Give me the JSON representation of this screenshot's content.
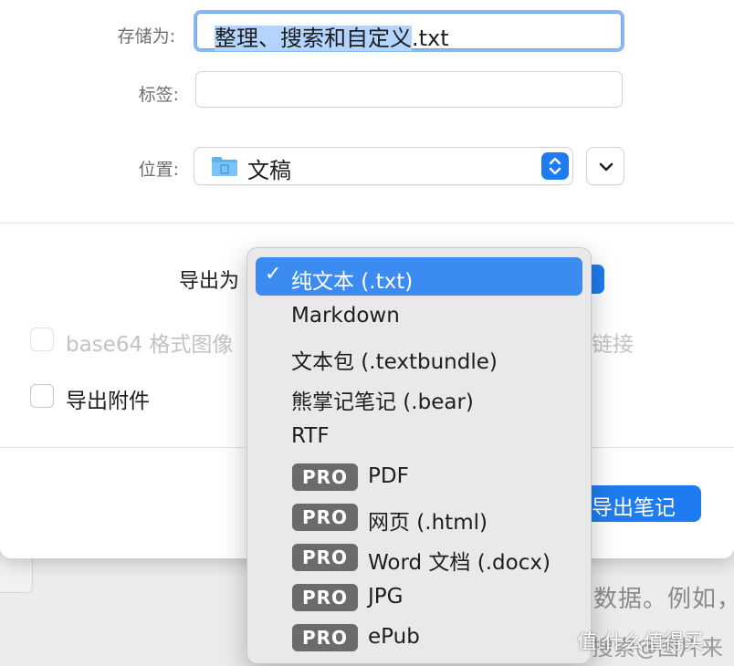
{
  "dialog": {
    "save_as_label": "存储为:",
    "filename_selected": "整理、搜索和自定义",
    "filename_ext": ".txt",
    "tags_label": "标签:",
    "tags_value": "",
    "location_label": "位置:",
    "location_value": "文稿",
    "export_label": "导出为",
    "base64_label": "base64 格式图像",
    "base64_tail": "链接",
    "attachments_label": "导出附件",
    "primary_button": "导出笔记"
  },
  "menu": {
    "checkmark": "✓",
    "pro_badge": "PRO",
    "items": [
      {
        "label": "纯文本 (.txt)",
        "selected": true,
        "pro": false
      },
      {
        "label": "Markdown",
        "selected": false,
        "pro": false
      },
      {
        "label": "文本包 (.textbundle)",
        "selected": false,
        "pro": false
      },
      {
        "label": "熊掌记笔记 (.bear)",
        "selected": false,
        "pro": false
      },
      {
        "label": "RTF",
        "selected": false,
        "pro": false
      },
      {
        "label": "PDF",
        "selected": false,
        "pro": true
      },
      {
        "label": "网页 (.html)",
        "selected": false,
        "pro": true
      },
      {
        "label": "Word 文档 (.docx)",
        "selected": false,
        "pro": true
      },
      {
        "label": "JPG",
        "selected": false,
        "pro": true
      },
      {
        "label": "ePub",
        "selected": false,
        "pro": true
      }
    ]
  },
  "background": {
    "line1": "",
    "line2": "数据。例如，",
    "line3": "搜索@图片来"
  },
  "watermark": {
    "text": "值 什么值得买"
  },
  "colors": {
    "accent": "#1e7cf0",
    "selection": "#b3d4fc",
    "pro_badge": "#6b6b6b"
  }
}
